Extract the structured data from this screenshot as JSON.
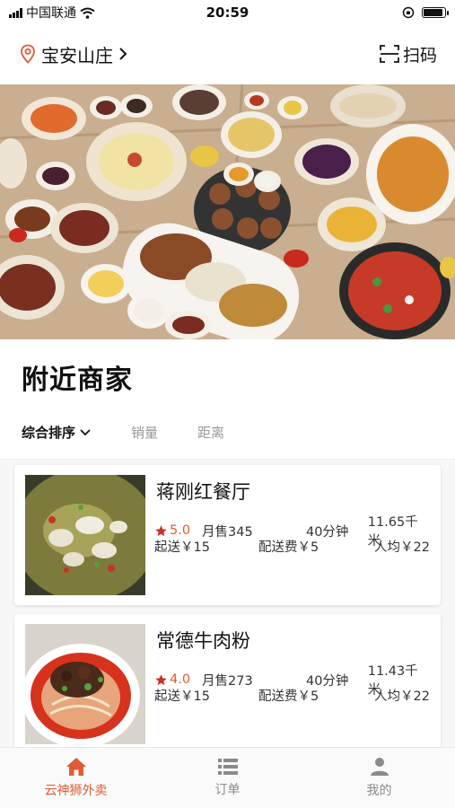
{
  "status_bar": {
    "carrier": "中国联通",
    "time": "20:59"
  },
  "header": {
    "location": "宝安山庄",
    "scan_label": "扫码"
  },
  "section": {
    "title": "附近商家"
  },
  "sort_bar": {
    "items": [
      "综合排序",
      "销量",
      "距离"
    ]
  },
  "restaurants": [
    {
      "name": "蒋刚红餐厅",
      "rating": "5.0",
      "monthly_sales": "月售345",
      "delivery_time": "40分钟",
      "distance": "11.65千米",
      "min_order": "起送￥15",
      "delivery_fee": "配送费￥5",
      "avg_price": "人均￥22"
    },
    {
      "name": "常德牛肉粉",
      "rating": "4.0",
      "monthly_sales": "月售273",
      "delivery_time": "40分钟",
      "distance": "11.43千米",
      "min_order": "起送￥15",
      "delivery_fee": "配送费￥5",
      "avg_price": "人均￥22"
    }
  ],
  "tab_bar": {
    "tabs": [
      {
        "label": "云神狮外卖",
        "icon": "home-icon",
        "active": true
      },
      {
        "label": "订单",
        "icon": "list-icon",
        "active": false
      },
      {
        "label": "我的",
        "icon": "user-icon",
        "active": false
      }
    ]
  },
  "colors": {
    "accent": "#e05b33",
    "text": "#111111",
    "muted": "#999999"
  }
}
